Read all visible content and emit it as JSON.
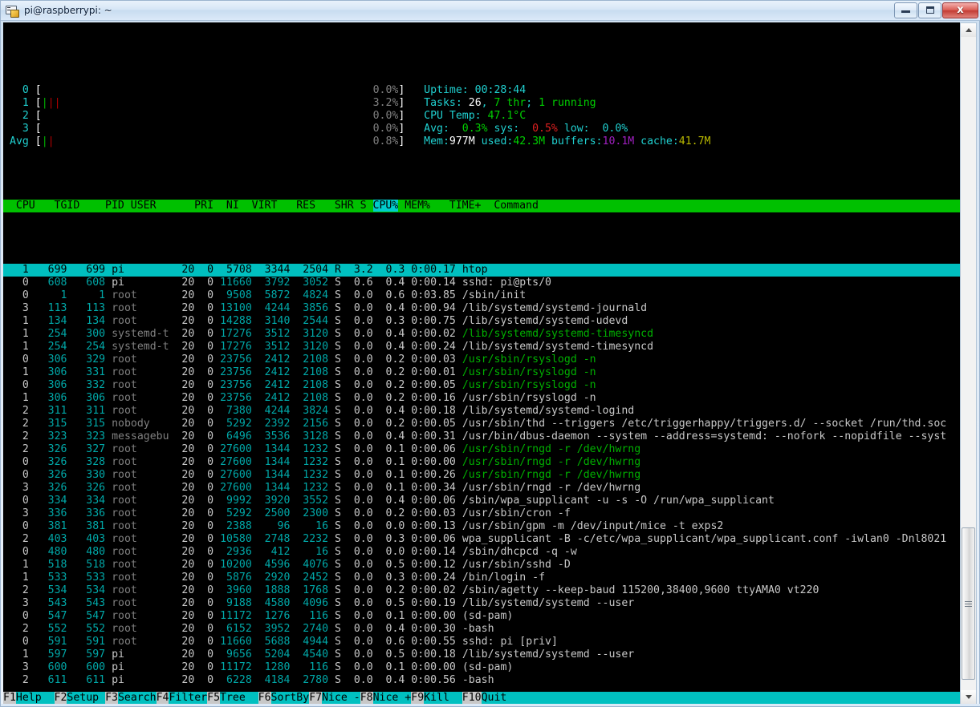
{
  "window": {
    "title": "pi@raspberrypi: ~",
    "icon": "terminal-icon",
    "minimize_label": "Minimize",
    "maximize_label": "Maximize",
    "close_label": "x"
  },
  "colors": {
    "header_bg": "#00c000",
    "selected_row_bg": "#00c0c0",
    "fnbar_bg": "#00c0c0",
    "fnkey_bg": "#c8c8c8",
    "terminal_bg": "#000000",
    "cyan": "#00a8a8",
    "green": "#00b000",
    "red": "#b00000",
    "magenta": "#a020c0",
    "yellow": "#b8b800"
  },
  "meters": {
    "cpus": [
      {
        "label": "0",
        "bar": "",
        "pct": "  0.0%"
      },
      {
        "label": "1",
        "bar": "|||",
        "pct": "  3.2%"
      },
      {
        "label": "2",
        "bar": "",
        "pct": "  0.0%"
      },
      {
        "label": "3",
        "bar": "",
        "pct": "  0.0%"
      },
      {
        "label": "Avg",
        "bar": "||",
        "pct": "  0.8%"
      }
    ],
    "bracket_open": "[",
    "bracket_close": "]",
    "right": {
      "uptime_label": "Uptime: ",
      "uptime_value": "00:28:44",
      "tasks_label": "Tasks: ",
      "tasks_count": "26",
      "tasks_sep1": ", ",
      "tasks_thr": "7 thr",
      "tasks_sep2": "; ",
      "tasks_running": "1 running",
      "cputemp_label": "CPU Temp: ",
      "cputemp_value": "47.1°C",
      "avg_label": "Avg:  ",
      "avg_value": "0.3%",
      "sys_label": " sys:  ",
      "sys_value": "0.5%",
      "low_label": " low:  ",
      "low_value": "0.0%",
      "mem_label": "Mem:",
      "mem_total": "977M",
      "mem_used_label": " used:",
      "mem_used": "42.3M",
      "mem_buffers_label": " buffers:",
      "mem_buffers": "10.1M",
      "mem_cache_label": " cache:",
      "mem_cache": "41.7M"
    }
  },
  "table": {
    "header": "  CPU   TGID    PID USER      PRI  NI  VIRT   RES   SHR S ",
    "header_cpu": "CPU%",
    "header_mem": " MEM%",
    "header_rest": "   TIME+  Command",
    "columns": [
      "CPU",
      "TGID",
      "PID",
      "USER",
      "PRI",
      "NI",
      "VIRT",
      "RES",
      "SHR",
      "S",
      "CPU%",
      "MEM%",
      "TIME+",
      "Command"
    ],
    "sort_column": "CPU%",
    "rows": [
      {
        "cpu": "  1",
        "tgid": "   699",
        "pid": "   699",
        "user": "pi        ",
        "pri": " 20",
        "ni": "  0",
        "virt": "  5708",
        "res": "  3344",
        "shr": "  2504",
        "s": "R",
        "cpupct": "  3.2",
        "mempct": "  0.3",
        "time": " 0:00.17",
        "cmd": "htop",
        "selected": true,
        "thread": false
      },
      {
        "cpu": "  0",
        "tgid": "   608",
        "pid": "   608",
        "user": "pi        ",
        "pri": " 20",
        "ni": "  0",
        "virt": " 11660",
        "res": "  3792",
        "shr": "  3052",
        "s": "S",
        "cpupct": "  0.6",
        "mempct": "  0.4",
        "time": " 0:00.14",
        "cmd": "sshd: pi@pts/0",
        "selected": false,
        "thread": false
      },
      {
        "cpu": "  0",
        "tgid": "     1",
        "pid": "     1",
        "user": "root      ",
        "pri": " 20",
        "ni": "  0",
        "virt": "  9508",
        "res": "  5872",
        "shr": "  4824",
        "s": "S",
        "cpupct": "  0.0",
        "mempct": "  0.6",
        "time": " 0:03.85",
        "cmd": "/sbin/init",
        "selected": false,
        "thread": false
      },
      {
        "cpu": "  3",
        "tgid": "   113",
        "pid": "   113",
        "user": "root      ",
        "pri": " 20",
        "ni": "  0",
        "virt": " 13100",
        "res": "  4244",
        "shr": "  3856",
        "s": "S",
        "cpupct": "  0.0",
        "mempct": "  0.4",
        "time": " 0:00.94",
        "cmd": "/lib/systemd/systemd-journald",
        "selected": false,
        "thread": false
      },
      {
        "cpu": "  1",
        "tgid": "   134",
        "pid": "   134",
        "user": "root      ",
        "pri": " 20",
        "ni": "  0",
        "virt": " 14288",
        "res": "  3140",
        "shr": "  2544",
        "s": "S",
        "cpupct": "  0.0",
        "mempct": "  0.3",
        "time": " 0:00.75",
        "cmd": "/lib/systemd/systemd-udevd",
        "selected": false,
        "thread": false
      },
      {
        "cpu": "  1",
        "tgid": "   254",
        "pid": "   300",
        "user": "systemd-t ",
        "pri": " 20",
        "ni": "  0",
        "virt": " 17276",
        "res": "  3512",
        "shr": "  3120",
        "s": "S",
        "cpupct": "  0.0",
        "mempct": "  0.4",
        "time": " 0:00.02",
        "cmd": "/lib/systemd/systemd-timesyncd",
        "selected": false,
        "thread": true
      },
      {
        "cpu": "  1",
        "tgid": "   254",
        "pid": "   254",
        "user": "systemd-t ",
        "pri": " 20",
        "ni": "  0",
        "virt": " 17276",
        "res": "  3512",
        "shr": "  3120",
        "s": "S",
        "cpupct": "  0.0",
        "mempct": "  0.4",
        "time": " 0:00.24",
        "cmd": "/lib/systemd/systemd-timesyncd",
        "selected": false,
        "thread": false
      },
      {
        "cpu": "  0",
        "tgid": "   306",
        "pid": "   329",
        "user": "root      ",
        "pri": " 20",
        "ni": "  0",
        "virt": " 23756",
        "res": "  2412",
        "shr": "  2108",
        "s": "S",
        "cpupct": "  0.0",
        "mempct": "  0.2",
        "time": " 0:00.03",
        "cmd": "/usr/sbin/rsyslogd -n",
        "selected": false,
        "thread": true
      },
      {
        "cpu": "  1",
        "tgid": "   306",
        "pid": "   331",
        "user": "root      ",
        "pri": " 20",
        "ni": "  0",
        "virt": " 23756",
        "res": "  2412",
        "shr": "  2108",
        "s": "S",
        "cpupct": "  0.0",
        "mempct": "  0.2",
        "time": " 0:00.01",
        "cmd": "/usr/sbin/rsyslogd -n",
        "selected": false,
        "thread": true
      },
      {
        "cpu": "  0",
        "tgid": "   306",
        "pid": "   332",
        "user": "root      ",
        "pri": " 20",
        "ni": "  0",
        "virt": " 23756",
        "res": "  2412",
        "shr": "  2108",
        "s": "S",
        "cpupct": "  0.0",
        "mempct": "  0.2",
        "time": " 0:00.05",
        "cmd": "/usr/sbin/rsyslogd -n",
        "selected": false,
        "thread": true
      },
      {
        "cpu": "  1",
        "tgid": "   306",
        "pid": "   306",
        "user": "root      ",
        "pri": " 20",
        "ni": "  0",
        "virt": " 23756",
        "res": "  2412",
        "shr": "  2108",
        "s": "S",
        "cpupct": "  0.0",
        "mempct": "  0.2",
        "time": " 0:00.16",
        "cmd": "/usr/sbin/rsyslogd -n",
        "selected": false,
        "thread": false
      },
      {
        "cpu": "  2",
        "tgid": "   311",
        "pid": "   311",
        "user": "root      ",
        "pri": " 20",
        "ni": "  0",
        "virt": "  7380",
        "res": "  4244",
        "shr": "  3824",
        "s": "S",
        "cpupct": "  0.0",
        "mempct": "  0.4",
        "time": " 0:00.18",
        "cmd": "/lib/systemd/systemd-logind",
        "selected": false,
        "thread": false
      },
      {
        "cpu": "  2",
        "tgid": "   315",
        "pid": "   315",
        "user": "nobody    ",
        "pri": " 20",
        "ni": "  0",
        "virt": "  5292",
        "res": "  2392",
        "shr": "  2156",
        "s": "S",
        "cpupct": "  0.0",
        "mempct": "  0.2",
        "time": " 0:00.05",
        "cmd": "/usr/sbin/thd --triggers /etc/triggerhappy/triggers.d/ --socket /run/thd.soc",
        "selected": false,
        "thread": false
      },
      {
        "cpu": "  2",
        "tgid": "   323",
        "pid": "   323",
        "user": "messagebu ",
        "pri": " 20",
        "ni": "  0",
        "virt": "  6496",
        "res": "  3536",
        "shr": "  3128",
        "s": "S",
        "cpupct": "  0.0",
        "mempct": "  0.4",
        "time": " 0:00.31",
        "cmd": "/usr/bin/dbus-daemon --system --address=systemd: --nofork --nopidfile --syst",
        "selected": false,
        "thread": false
      },
      {
        "cpu": "  2",
        "tgid": "   326",
        "pid": "   327",
        "user": "root      ",
        "pri": " 20",
        "ni": "  0",
        "virt": " 27600",
        "res": "  1344",
        "shr": "  1232",
        "s": "S",
        "cpupct": "  0.0",
        "mempct": "  0.1",
        "time": " 0:00.06",
        "cmd": "/usr/sbin/rngd -r /dev/hwrng",
        "selected": false,
        "thread": true
      },
      {
        "cpu": "  0",
        "tgid": "   326",
        "pid": "   328",
        "user": "root      ",
        "pri": " 20",
        "ni": "  0",
        "virt": " 27600",
        "res": "  1344",
        "shr": "  1232",
        "s": "S",
        "cpupct": "  0.0",
        "mempct": "  0.1",
        "time": " 0:00.00",
        "cmd": "/usr/sbin/rngd -r /dev/hwrng",
        "selected": false,
        "thread": true
      },
      {
        "cpu": "  0",
        "tgid": "   326",
        "pid": "   330",
        "user": "root      ",
        "pri": " 20",
        "ni": "  0",
        "virt": " 27600",
        "res": "  1344",
        "shr": "  1232",
        "s": "S",
        "cpupct": "  0.0",
        "mempct": "  0.1",
        "time": " 0:00.26",
        "cmd": "/usr/sbin/rngd -r /dev/hwrng",
        "selected": false,
        "thread": true
      },
      {
        "cpu": "  3",
        "tgid": "   326",
        "pid": "   326",
        "user": "root      ",
        "pri": " 20",
        "ni": "  0",
        "virt": " 27600",
        "res": "  1344",
        "shr": "  1232",
        "s": "S",
        "cpupct": "  0.0",
        "mempct": "  0.1",
        "time": " 0:00.34",
        "cmd": "/usr/sbin/rngd -r /dev/hwrng",
        "selected": false,
        "thread": false
      },
      {
        "cpu": "  0",
        "tgid": "   334",
        "pid": "   334",
        "user": "root      ",
        "pri": " 20",
        "ni": "  0",
        "virt": "  9992",
        "res": "  3920",
        "shr": "  3552",
        "s": "S",
        "cpupct": "  0.0",
        "mempct": "  0.4",
        "time": " 0:00.06",
        "cmd": "/sbin/wpa_supplicant -u -s -O /run/wpa_supplicant",
        "selected": false,
        "thread": false
      },
      {
        "cpu": "  3",
        "tgid": "   336",
        "pid": "   336",
        "user": "root      ",
        "pri": " 20",
        "ni": "  0",
        "virt": "  5292",
        "res": "  2500",
        "shr": "  2300",
        "s": "S",
        "cpupct": "  0.0",
        "mempct": "  0.2",
        "time": " 0:00.03",
        "cmd": "/usr/sbin/cron -f",
        "selected": false,
        "thread": false
      },
      {
        "cpu": "  0",
        "tgid": "   381",
        "pid": "   381",
        "user": "root      ",
        "pri": " 20",
        "ni": "  0",
        "virt": "  2388",
        "res": "    96",
        "shr": "    16",
        "s": "S",
        "cpupct": "  0.0",
        "mempct": "  0.0",
        "time": " 0:00.13",
        "cmd": "/usr/sbin/gpm -m /dev/input/mice -t exps2",
        "selected": false,
        "thread": false
      },
      {
        "cpu": "  2",
        "tgid": "   403",
        "pid": "   403",
        "user": "root      ",
        "pri": " 20",
        "ni": "  0",
        "virt": " 10580",
        "res": "  2748",
        "shr": "  2232",
        "s": "S",
        "cpupct": "  0.0",
        "mempct": "  0.3",
        "time": " 0:00.06",
        "cmd": "wpa_supplicant -B -c/etc/wpa_supplicant/wpa_supplicant.conf -iwlan0 -Dnl8021",
        "selected": false,
        "thread": false
      },
      {
        "cpu": "  0",
        "tgid": "   480",
        "pid": "   480",
        "user": "root      ",
        "pri": " 20",
        "ni": "  0",
        "virt": "  2936",
        "res": "   412",
        "shr": "    16",
        "s": "S",
        "cpupct": "  0.0",
        "mempct": "  0.0",
        "time": " 0:00.14",
        "cmd": "/sbin/dhcpcd -q -w",
        "selected": false,
        "thread": false
      },
      {
        "cpu": "  1",
        "tgid": "   518",
        "pid": "   518",
        "user": "root      ",
        "pri": " 20",
        "ni": "  0",
        "virt": " 10200",
        "res": "  4596",
        "shr": "  4076",
        "s": "S",
        "cpupct": "  0.0",
        "mempct": "  0.5",
        "time": " 0:00.12",
        "cmd": "/usr/sbin/sshd -D",
        "selected": false,
        "thread": false
      },
      {
        "cpu": "  1",
        "tgid": "   533",
        "pid": "   533",
        "user": "root      ",
        "pri": " 20",
        "ni": "  0",
        "virt": "  5876",
        "res": "  2920",
        "shr": "  2452",
        "s": "S",
        "cpupct": "  0.0",
        "mempct": "  0.3",
        "time": " 0:00.24",
        "cmd": "/bin/login -f",
        "selected": false,
        "thread": false
      },
      {
        "cpu": "  2",
        "tgid": "   534",
        "pid": "   534",
        "user": "root      ",
        "pri": " 20",
        "ni": "  0",
        "virt": "  3960",
        "res": "  1888",
        "shr": "  1768",
        "s": "S",
        "cpupct": "  0.0",
        "mempct": "  0.2",
        "time": " 0:00.02",
        "cmd": "/sbin/agetty --keep-baud 115200,38400,9600 ttyAMA0 vt220",
        "selected": false,
        "thread": false
      },
      {
        "cpu": "  3",
        "tgid": "   543",
        "pid": "   543",
        "user": "root      ",
        "pri": " 20",
        "ni": "  0",
        "virt": "  9188",
        "res": "  4580",
        "shr": "  4096",
        "s": "S",
        "cpupct": "  0.0",
        "mempct": "  0.5",
        "time": " 0:00.19",
        "cmd": "/lib/systemd/systemd --user",
        "selected": false,
        "thread": false
      },
      {
        "cpu": "  0",
        "tgid": "   547",
        "pid": "   547",
        "user": "root      ",
        "pri": " 20",
        "ni": "  0",
        "virt": " 11172",
        "res": "  1276",
        "shr": "   116",
        "s": "S",
        "cpupct": "  0.0",
        "mempct": "  0.1",
        "time": " 0:00.00",
        "cmd": "(sd-pam)",
        "selected": false,
        "thread": false
      },
      {
        "cpu": "  2",
        "tgid": "   552",
        "pid": "   552",
        "user": "root      ",
        "pri": " 20",
        "ni": "  0",
        "virt": "  6152",
        "res": "  3952",
        "shr": "  2740",
        "s": "S",
        "cpupct": "  0.0",
        "mempct": "  0.4",
        "time": " 0:00.30",
        "cmd": "-bash",
        "selected": false,
        "thread": false
      },
      {
        "cpu": "  0",
        "tgid": "   591",
        "pid": "   591",
        "user": "root      ",
        "pri": " 20",
        "ni": "  0",
        "virt": " 11660",
        "res": "  5688",
        "shr": "  4944",
        "s": "S",
        "cpupct": "  0.0",
        "mempct": "  0.6",
        "time": " 0:00.55",
        "cmd": "sshd: pi [priv]",
        "selected": false,
        "thread": false
      },
      {
        "cpu": "  1",
        "tgid": "   597",
        "pid": "   597",
        "user": "pi        ",
        "pri": " 20",
        "ni": "  0",
        "virt": "  9656",
        "res": "  5204",
        "shr": "  4540",
        "s": "S",
        "cpupct": "  0.0",
        "mempct": "  0.5",
        "time": " 0:00.18",
        "cmd": "/lib/systemd/systemd --user",
        "selected": false,
        "thread": false
      },
      {
        "cpu": "  3",
        "tgid": "   600",
        "pid": "   600",
        "user": "pi        ",
        "pri": " 20",
        "ni": "  0",
        "virt": " 11172",
        "res": "  1280",
        "shr": "   116",
        "s": "S",
        "cpupct": "  0.0",
        "mempct": "  0.1",
        "time": " 0:00.00",
        "cmd": "(sd-pam)",
        "selected": false,
        "thread": false
      },
      {
        "cpu": "  2",
        "tgid": "   611",
        "pid": "   611",
        "user": "pi        ",
        "pri": " 20",
        "ni": "  0",
        "virt": "  6228",
        "res": "  4184",
        "shr": "  2780",
        "s": "S",
        "cpupct": "  0.0",
        "mempct": "  0.4",
        "time": " 0:00.56",
        "cmd": "-bash",
        "selected": false,
        "thread": false
      }
    ]
  },
  "function_bar": [
    {
      "key": "F1",
      "label": "Help  "
    },
    {
      "key": "F2",
      "label": "Setup "
    },
    {
      "key": "F3",
      "label": "Search"
    },
    {
      "key": "F4",
      "label": "Filter"
    },
    {
      "key": "F5",
      "label": "Tree  "
    },
    {
      "key": "F6",
      "label": "SortBy"
    },
    {
      "key": "F7",
      "label": "Nice -"
    },
    {
      "key": "F8",
      "label": "Nice +"
    },
    {
      "key": "F9",
      "label": "Kill  "
    },
    {
      "key": "F10",
      "label": "Quit  "
    }
  ],
  "scrollbar": {
    "up_arrow": "▲",
    "down_arrow": "▼"
  }
}
